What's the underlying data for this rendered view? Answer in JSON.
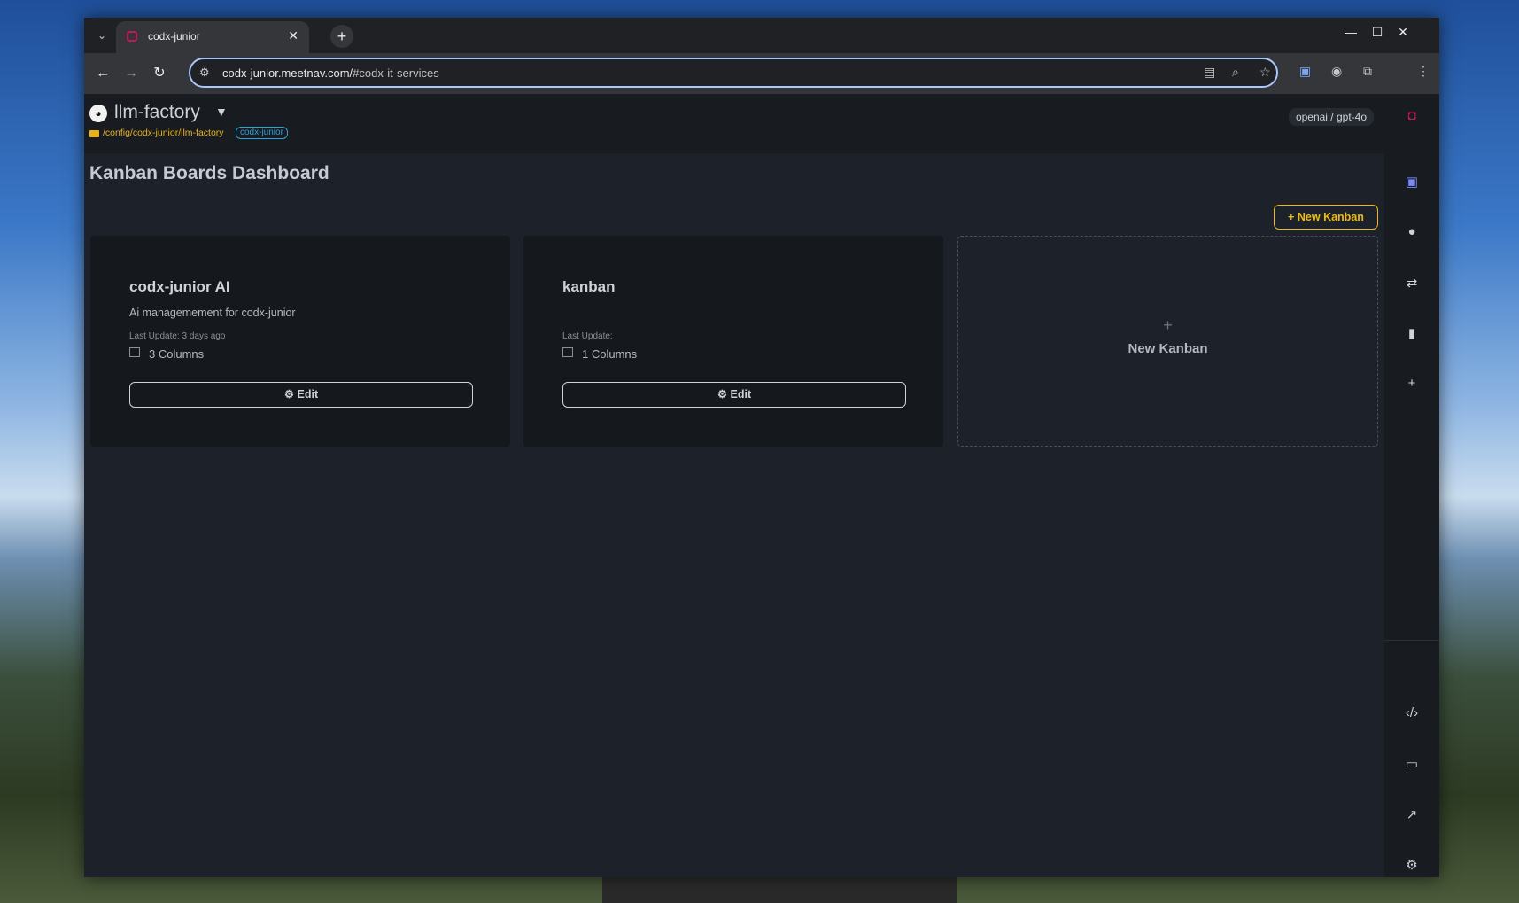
{
  "browser": {
    "tab_title": "codx-junior",
    "url_host": "codx-junior.meetnav.com/",
    "url_path": "#codx-it-services"
  },
  "header": {
    "project_name": "llm-factory",
    "project_path": "/config/codx-junior/llm-factory",
    "project_badge": "codx-junior",
    "model": "openai / gpt-4o"
  },
  "main": {
    "title": "Kanban Boards Dashboard",
    "new_kanban_button": "New Kanban",
    "cards": [
      {
        "title": "codx-junior AI",
        "description": "Ai managemement for codx-junior",
        "last_update": "Last Update: 3 days ago",
        "columns": "3 Columns",
        "edit_label": "Edit"
      },
      {
        "title": "kanban",
        "description": "",
        "last_update": "Last Update:",
        "columns": "1 Columns",
        "edit_label": "Edit"
      }
    ],
    "new_card_label": "New Kanban"
  },
  "colors": {
    "accent": "#f0b90b",
    "badge": "#2aa3d9",
    "brand": "#c2185b"
  }
}
